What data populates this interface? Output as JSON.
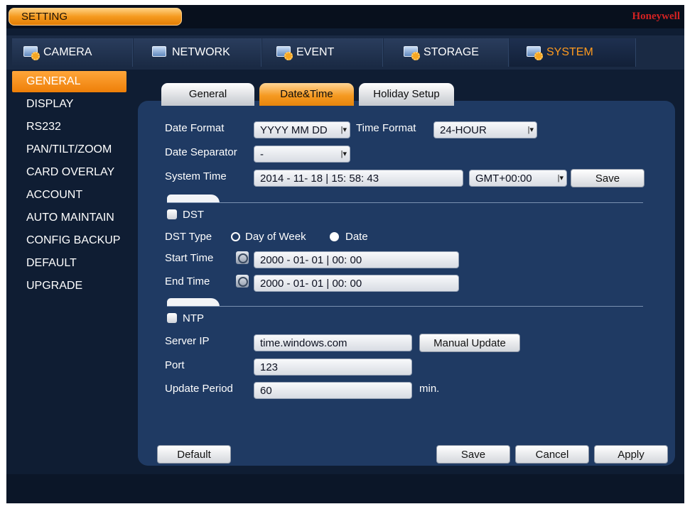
{
  "titlebar": {
    "setting_label": "SETTING",
    "brand": "Honeywell"
  },
  "main_tabs": [
    {
      "label": "CAMERA",
      "icon": "camera-icon"
    },
    {
      "label": "NETWORK",
      "icon": "network-icon"
    },
    {
      "label": "EVENT",
      "icon": "event-icon"
    },
    {
      "label": "STORAGE",
      "icon": "storage-icon"
    },
    {
      "label": "SYSTEM",
      "icon": "system-icon",
      "active": true
    }
  ],
  "sidebar": {
    "items": [
      {
        "label": "GENERAL",
        "active": true
      },
      {
        "label": "DISPLAY"
      },
      {
        "label": "RS232"
      },
      {
        "label": "PAN/TILT/ZOOM"
      },
      {
        "label": "CARD OVERLAY"
      },
      {
        "label": "ACCOUNT"
      },
      {
        "label": "AUTO MAINTAIN"
      },
      {
        "label": "CONFIG BACKUP"
      },
      {
        "label": "DEFAULT"
      },
      {
        "label": "UPGRADE"
      }
    ]
  },
  "sub_tabs": [
    {
      "label": "General"
    },
    {
      "label": "Date&Time",
      "active": true
    },
    {
      "label": "Holiday Setup"
    }
  ],
  "datetime": {
    "date_format_label": "Date Format",
    "date_format_value": "YYYY MM DD",
    "time_format_label": "Time Format",
    "time_format_value": "24-HOUR",
    "date_separator_label": "Date Separator",
    "date_separator_value": "-",
    "system_time_label": "System Time",
    "system_time_value": "2014 - 11- 18 | 15: 58: 43",
    "timezone_value": "GMT+00:00",
    "save_label": "Save"
  },
  "dst": {
    "checkbox_label": "DST",
    "type_label": "DST Type",
    "option_week": "Day of Week",
    "option_date": "Date",
    "selected": "Date",
    "start_label": "Start Time",
    "start_value": "2000 -  01-  01 |  00:  00",
    "end_label": "End Time",
    "end_value": "2000 -  01-  01 |  00:  00"
  },
  "ntp": {
    "checkbox_label": "NTP",
    "server_label": "Server IP",
    "server_value": "time.windows.com",
    "manual_update_label": "Manual Update",
    "port_label": "Port",
    "port_value": "123",
    "period_label": "Update Period",
    "period_value": "60",
    "period_unit": "min."
  },
  "footer": {
    "default_label": "Default",
    "save_label": "Save",
    "cancel_label": "Cancel",
    "apply_label": "Apply"
  },
  "colors": {
    "accent": "#f59a1e",
    "background": "#0f1d33",
    "panel": "#1f3a63",
    "brand": "#d32222"
  }
}
